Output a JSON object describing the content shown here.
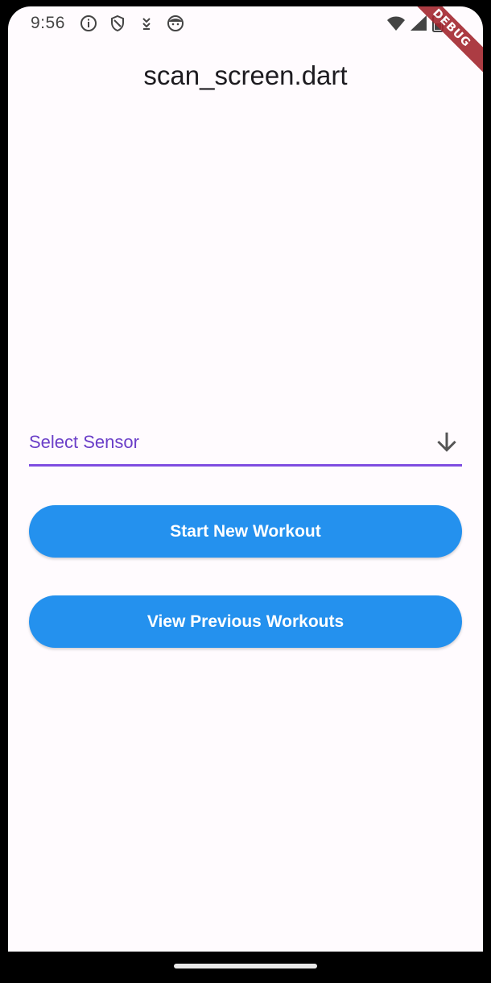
{
  "status_bar": {
    "time": "9:56",
    "icons": [
      "info-icon",
      "shield-icon",
      "download-arrow-icon",
      "face-icon",
      "wifi-icon",
      "signal-icon",
      "battery-icon"
    ]
  },
  "debug_banner": "DEBUG",
  "app_bar": {
    "title": "scan_screen.dart"
  },
  "sensor_dropdown": {
    "hint": "Select Sensor",
    "icon": "arrow-down-icon",
    "accent_color": "#7f4de1"
  },
  "buttons": {
    "start_label": "Start New Workout",
    "view_label": "View Previous Workouts",
    "color": "#2491ee"
  }
}
